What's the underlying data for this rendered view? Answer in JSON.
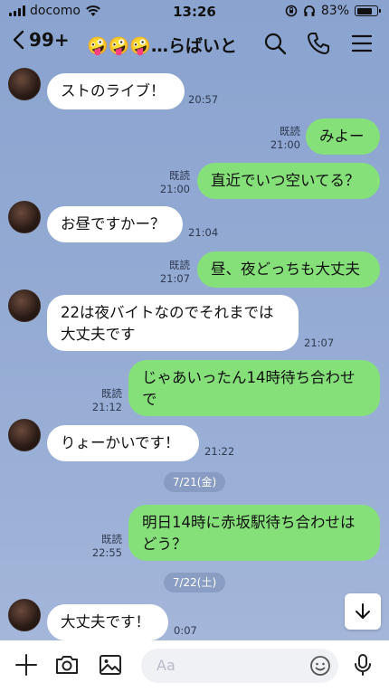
{
  "status": {
    "carrier": "docomo",
    "time": "13:26",
    "battery_percent": "83%",
    "battery_level": 0.83
  },
  "header": {
    "back_count": "99+",
    "chat_title": "🤪🤪🤪…らばいと"
  },
  "messages": [
    {
      "dir": "in",
      "text": "ストのライブ！",
      "time": "20:57"
    },
    {
      "dir": "out",
      "text": "みよー",
      "read": "既読",
      "time": "21:00"
    },
    {
      "dir": "out",
      "text": "直近でいつ空いてる？",
      "read": "既読",
      "time": "21:00"
    },
    {
      "dir": "in",
      "text": "お昼ですかー？",
      "time": "21:04"
    },
    {
      "dir": "out",
      "text": "昼、夜どっちも大丈夫",
      "read": "既読",
      "time": "21:07"
    },
    {
      "dir": "in",
      "line1": "22は夜バイトなのでそれまでは",
      "line2": "大丈夫です",
      "time": "21:07"
    },
    {
      "dir": "out",
      "line1": "じゃあいったん14時待ち合わせ",
      "line2": "で",
      "read": "既読",
      "time": "21:12"
    },
    {
      "dir": "in",
      "text": "りょーかいです！",
      "time": "21:22"
    },
    {
      "dir": "out",
      "line1": "明日14時に赤坂駅待ち合わせは",
      "line2": "どう？",
      "read": "既読",
      "time": "22:55"
    },
    {
      "dir": "in",
      "text": "大丈夫です！",
      "time": "0:07"
    }
  ],
  "dates": {
    "d1": "7/21(金)",
    "d2": "7/22(土)"
  },
  "input": {
    "placeholder": "Aa"
  }
}
